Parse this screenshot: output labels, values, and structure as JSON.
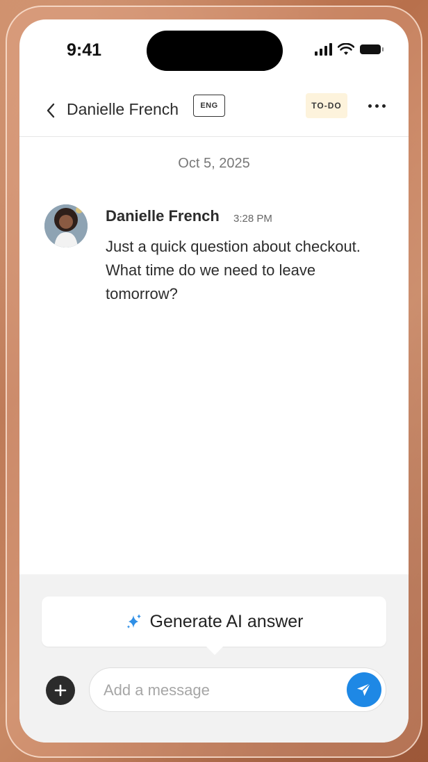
{
  "status_bar": {
    "time": "9:41"
  },
  "header": {
    "contact_name": "Danielle French",
    "language_badge": "ENG",
    "status_badge": "TO-DO",
    "back_icon": "chevron-left-icon",
    "more_icon": "more-horizontal-icon"
  },
  "conversation": {
    "date": "Oct 5, 2025",
    "messages": [
      {
        "sender": "Danielle French",
        "time": "3:28 PM",
        "text": "Just a quick question about checkout. What time do we need to leave tomorrow?"
      }
    ]
  },
  "composer": {
    "ai_button_label": "Generate AI answer",
    "ai_icon": "sparkle-icon",
    "input_placeholder": "Add a message",
    "input_value": "",
    "add_icon": "plus-icon",
    "send_icon": "send-icon"
  },
  "colors": {
    "accent": "#1e88e5",
    "todo_badge_bg": "#fdf3dc",
    "sparkle": "#2f8fe6"
  }
}
